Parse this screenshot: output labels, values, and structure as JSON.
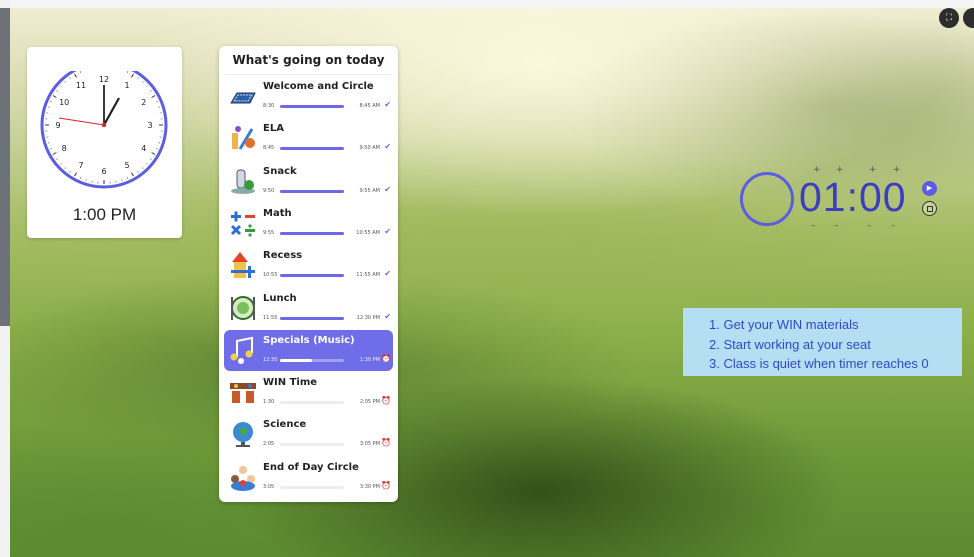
{
  "clock": {
    "time_label": "1:00 PM",
    "numerals": [
      "12",
      "1",
      "2",
      "3",
      "4",
      "5",
      "6",
      "7",
      "8",
      "9",
      "10",
      "11"
    ]
  },
  "schedule": {
    "title": "What's going on today",
    "items": [
      {
        "name": "Welcome and Circle",
        "start": "8:30",
        "end": "8:45 AM",
        "progress": 1.0,
        "status": "done",
        "icon": "mat-icon"
      },
      {
        "name": "ELA",
        "start": "8:45",
        "end": "9:50 AM",
        "progress": 1.0,
        "status": "done",
        "icon": "art-supplies-icon"
      },
      {
        "name": "Snack",
        "start": "9:50",
        "end": "9:55 AM",
        "progress": 1.0,
        "status": "done",
        "icon": "snack-icon"
      },
      {
        "name": "Math",
        "start": "9:55",
        "end": "10:55 AM",
        "progress": 1.0,
        "status": "done",
        "icon": "math-symbols-icon"
      },
      {
        "name": "Recess",
        "start": "10:55",
        "end": "11:55 AM",
        "progress": 1.0,
        "status": "done",
        "icon": "playground-icon"
      },
      {
        "name": "Lunch",
        "start": "11:55",
        "end": "12:30 PM",
        "progress": 1.0,
        "status": "done",
        "icon": "plate-utensils-icon"
      },
      {
        "name": "Specials (Music)",
        "start": "12:30",
        "end": "1:30 PM",
        "progress": 0.5,
        "status": "current",
        "icon": "music-notes-icon"
      },
      {
        "name": "WIN Time",
        "start": "1:30",
        "end": "2:05 PM",
        "progress": 0.0,
        "status": "upcoming",
        "icon": "classroom-icon"
      },
      {
        "name": "Science",
        "start": "2:05",
        "end": "3:05 PM",
        "progress": 0.0,
        "status": "upcoming",
        "icon": "globe-icon"
      },
      {
        "name": "End of Day Circle",
        "start": "3:05",
        "end": "3:30 PM",
        "progress": 0.0,
        "status": "upcoming",
        "icon": "kids-circle-icon"
      }
    ]
  },
  "timer": {
    "display": "01:00",
    "adjust_up": [
      "+",
      "+",
      "+",
      "+"
    ],
    "adjust_down": [
      "–",
      "–",
      "–",
      "–"
    ]
  },
  "instructions": {
    "lines": [
      "1. Get your WIN materials",
      "2. Start working at your seat",
      "3. Class is quiet when timer reaches 0"
    ]
  },
  "colors": {
    "accent": "#6f6ee8",
    "timer": "#3b3ec0",
    "instructions_bg": "#b6e0fc",
    "instructions_text": "#3547c8"
  }
}
